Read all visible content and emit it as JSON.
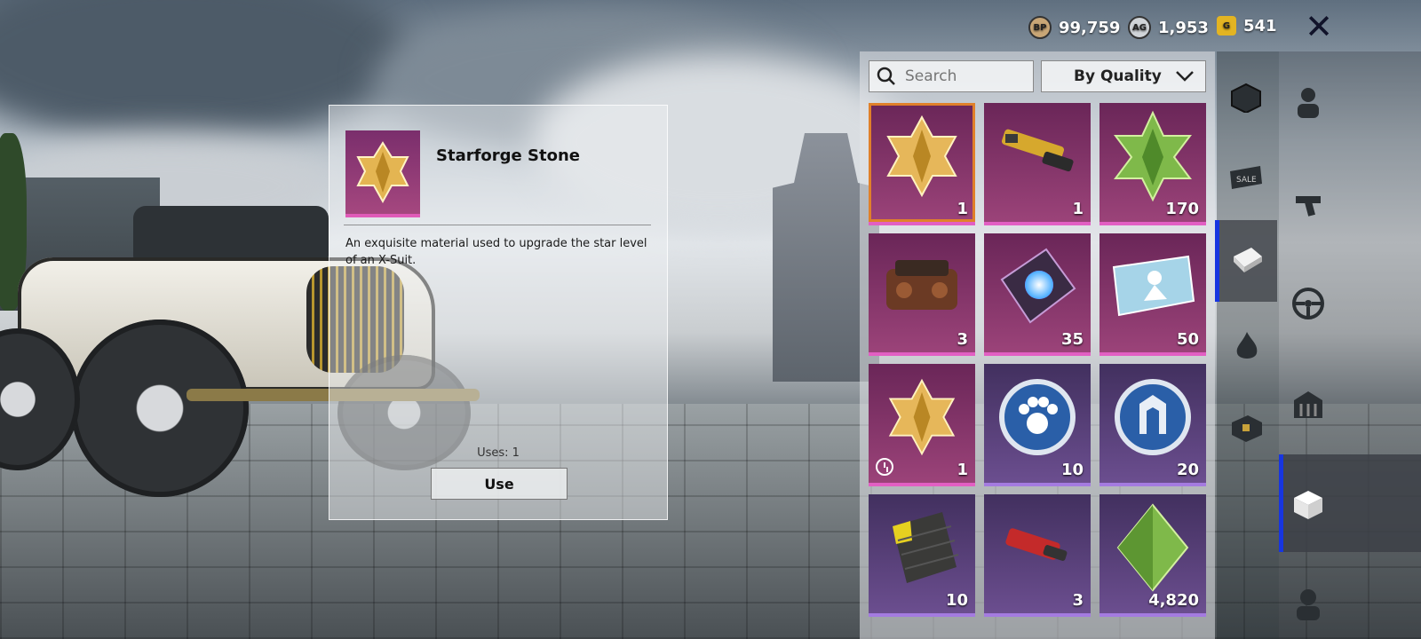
{
  "currencies": [
    {
      "icon": "bp-coin-icon",
      "symbol": "BP",
      "value": "99,759",
      "color": "#c8a676"
    },
    {
      "icon": "ag-coin-icon",
      "symbol": "AG",
      "value": "1,953",
      "color": "#d0d4d8"
    },
    {
      "icon": "gold-g-icon",
      "symbol": "G",
      "value": "541",
      "color": "#e3b422"
    }
  ],
  "detail": {
    "title": "Starforge Stone",
    "description": "An exquisite material used to upgrade the star level of an X-Suit.",
    "uses_label": "Uses: 1",
    "use_button": "Use"
  },
  "inventory": {
    "search_placeholder": "Search",
    "sort_label": "By Quality",
    "items": [
      {
        "name": "starforge-stone",
        "icon": "gold-star-stone-icon",
        "qty": "1",
        "rarity": "pink",
        "selected": true
      },
      {
        "name": "gun-part",
        "icon": "gold-gun-part-icon",
        "qty": "1",
        "rarity": "pink"
      },
      {
        "name": "green-crystal",
        "icon": "green-crystal-icon",
        "qty": "170",
        "rarity": "pink"
      },
      {
        "name": "engine",
        "icon": "engine-icon",
        "qty": "3",
        "rarity": "pink"
      },
      {
        "name": "paint-card",
        "icon": "paint-card-icon",
        "qty": "35",
        "rarity": "pink"
      },
      {
        "name": "photo-card",
        "icon": "photo-card-icon",
        "qty": "50",
        "rarity": "pink"
      },
      {
        "name": "starforge-stone-timed",
        "icon": "gold-star-stone-icon",
        "qty": "1",
        "rarity": "pink",
        "timed": true
      },
      {
        "name": "paw-coin",
        "icon": "paw-coin-icon",
        "qty": "10",
        "rarity": "purple"
      },
      {
        "name": "badge-coin",
        "icon": "badge-coin-icon",
        "qty": "20",
        "rarity": "purple"
      },
      {
        "name": "fabric-swatch",
        "icon": "fabric-swatch-icon",
        "qty": "10",
        "rarity": "purple"
      },
      {
        "name": "red-attachment",
        "icon": "red-attachment-icon",
        "qty": "3",
        "rarity": "purple"
      },
      {
        "name": "green-gem",
        "icon": "green-gem-icon",
        "qty": "4,820",
        "rarity": "purple"
      }
    ]
  },
  "categories": [
    "box-icon",
    "character-icon",
    "sale-icon",
    "gun-icon",
    "crate-icon",
    "steering-wheel-icon",
    "fire-icon",
    "building-icon",
    "treasure-box-icon",
    "open-box-icon",
    "avatar-icon"
  ],
  "close_icon": "close-icon"
}
